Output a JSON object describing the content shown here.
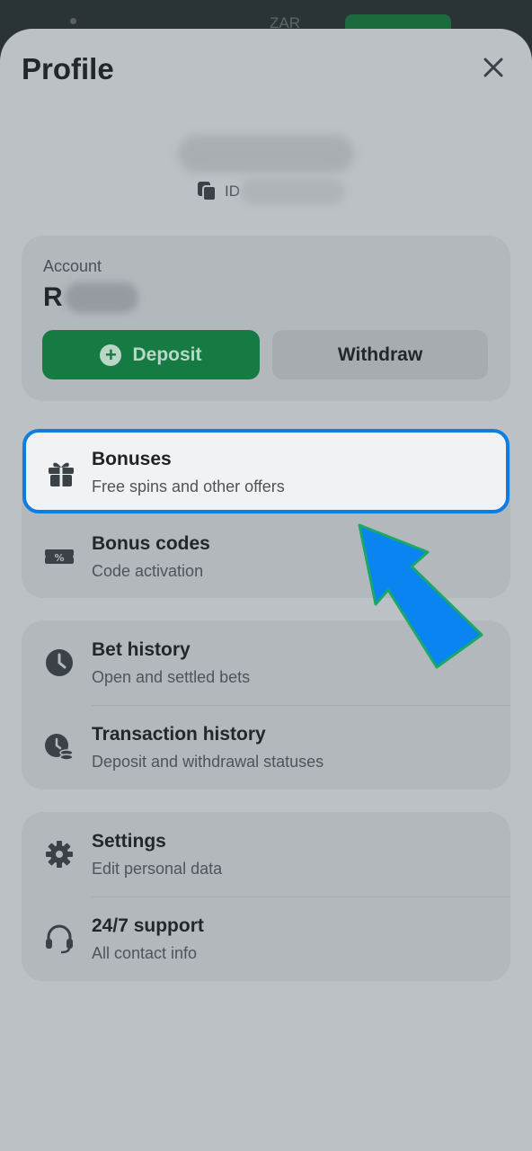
{
  "background": {
    "currency": "ZAR"
  },
  "header": {
    "title": "Profile",
    "close_icon": "close-icon"
  },
  "user": {
    "id_label": "ID"
  },
  "account": {
    "label": "Account",
    "currency_symbol": "R",
    "deposit_label": "Deposit",
    "withdraw_label": "Withdraw"
  },
  "menu": {
    "bonuses": {
      "title": "Bonuses",
      "subtitle": "Free spins and other offers",
      "icon": "gift-icon"
    },
    "bonus_codes": {
      "title": "Bonus codes",
      "subtitle": "Code activation",
      "icon": "coupon-icon"
    },
    "bet_history": {
      "title": "Bet history",
      "subtitle": "Open and settled bets",
      "icon": "clock-icon"
    },
    "transaction_history": {
      "title": "Transaction history",
      "subtitle": "Deposit and withdrawal statuses",
      "icon": "clock-coins-icon"
    },
    "settings": {
      "title": "Settings",
      "subtitle": "Edit personal data",
      "icon": "gear-icon"
    },
    "support": {
      "title": "24/7 support",
      "subtitle": "All contact info",
      "icon": "headset-icon"
    }
  },
  "colors": {
    "accent": "#0f7de0",
    "deposit": "#167a43",
    "arrow": "#0a84f0"
  }
}
